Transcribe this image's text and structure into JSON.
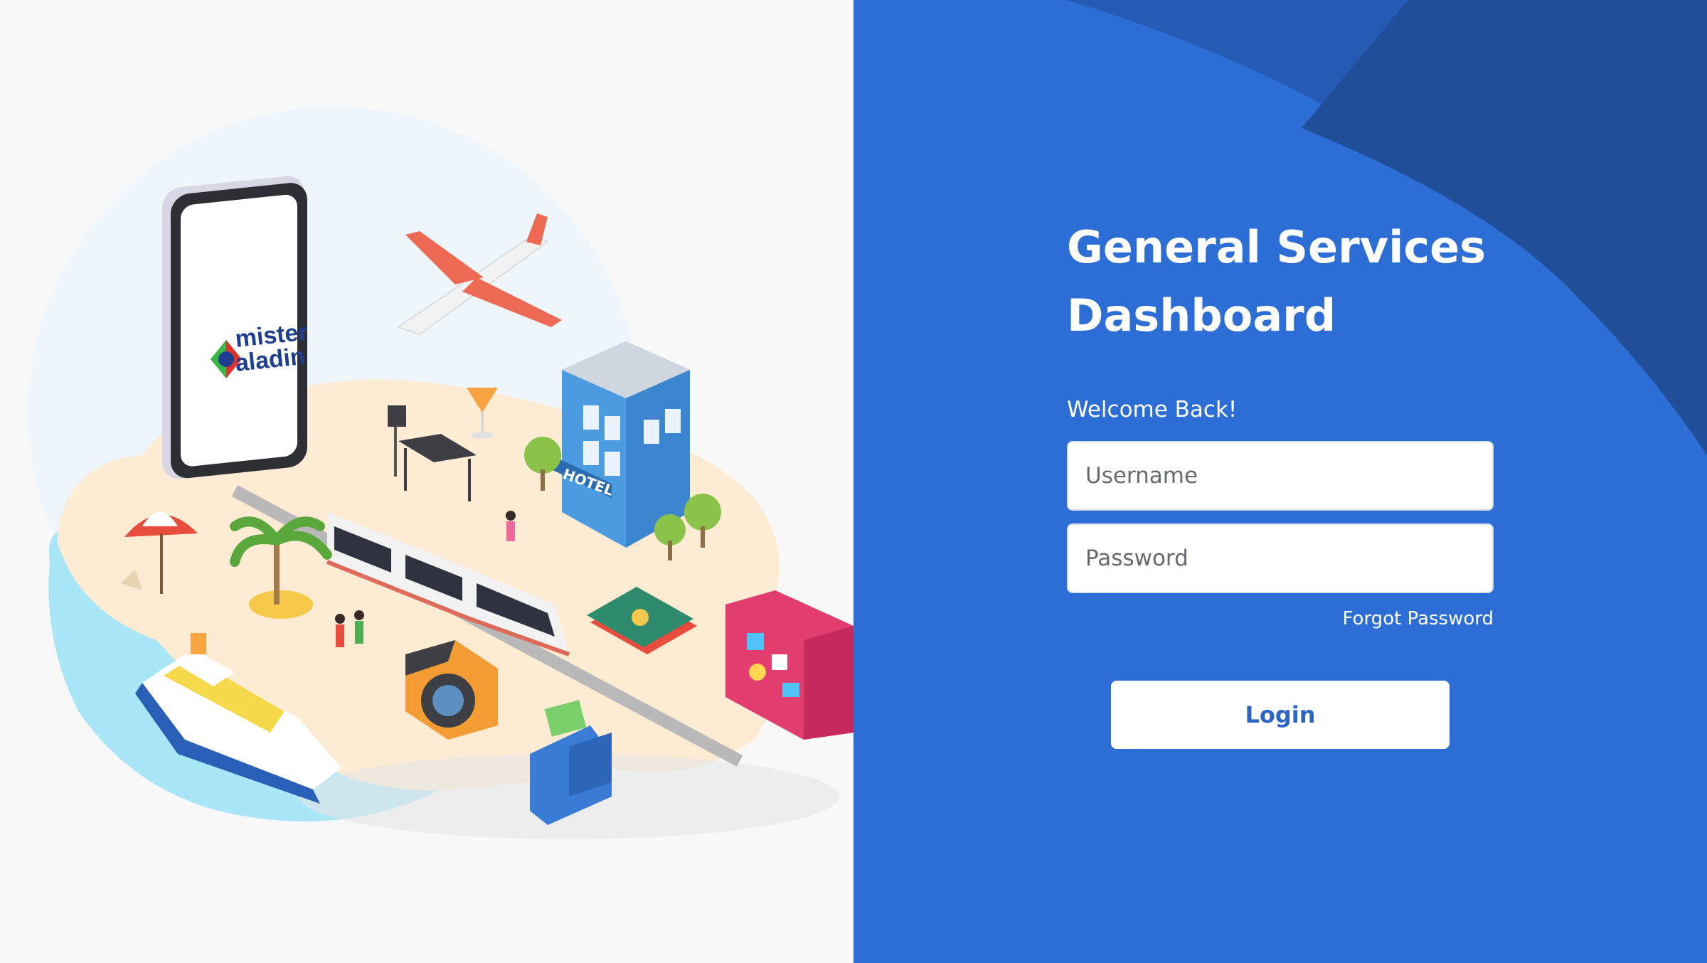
{
  "login": {
    "title_line1": "General Services",
    "title_line2": "Dashboard",
    "welcome": "Welcome Back!",
    "username_placeholder": "Username",
    "password_placeholder": "Password",
    "forgot_password": "Forgot Password",
    "login_button": "Login"
  },
  "brand": {
    "logo_text_line1": "mister",
    "logo_text_line2": "aladin"
  },
  "colors": {
    "primary": "#2b66c6",
    "primary_dark": "#1f4f9a",
    "background_left": "#f8f8f8"
  },
  "illustration": {
    "hotel_sign": "HOTEL",
    "icons": [
      "phone-icon",
      "airplane-icon",
      "hotel-icon",
      "train-icon",
      "cruise-ship-icon",
      "camera-icon",
      "wallet-icon",
      "suitcase-icon",
      "passport-icon",
      "beach-umbrella-icon",
      "palm-tree-icon",
      "bus-stop-icon",
      "cocktail-icon"
    ]
  }
}
